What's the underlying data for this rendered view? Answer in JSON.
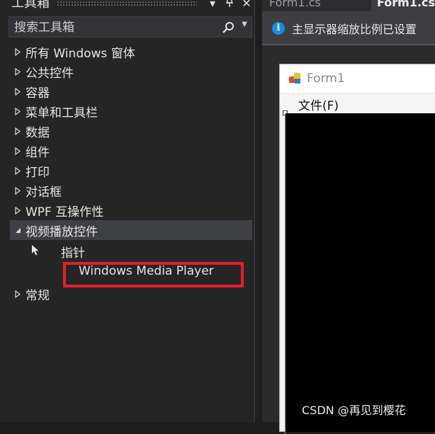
{
  "toolbox": {
    "title": "工具箱",
    "search_placeholder": "搜索工具箱",
    "groups": [
      {
        "label": "所有 Windows 窗体",
        "expanded": false
      },
      {
        "label": "公共控件",
        "expanded": false
      },
      {
        "label": "容器",
        "expanded": false
      },
      {
        "label": "菜单和工具栏",
        "expanded": false
      },
      {
        "label": "数据",
        "expanded": false
      },
      {
        "label": "组件",
        "expanded": false
      },
      {
        "label": "打印",
        "expanded": false
      },
      {
        "label": "对话框",
        "expanded": false
      },
      {
        "label": "WPF 互操作性",
        "expanded": false
      },
      {
        "label": "视频播放控件",
        "expanded": true
      },
      {
        "label": "常规",
        "expanded": false
      }
    ],
    "video_items": {
      "pointer": "指针",
      "wmp": "Windows Media Player"
    }
  },
  "editor": {
    "tabs": [
      "Form1.cs",
      "Form1.cs"
    ],
    "infobar_text": "主显示器缩放比例已设置",
    "form": {
      "title": "Form1",
      "menu_file": "文件(F)"
    }
  },
  "watermark": "CSDN @再见到樱花",
  "colors": {
    "highlight": "#e51f25",
    "info_icon": "#1b8be0"
  }
}
